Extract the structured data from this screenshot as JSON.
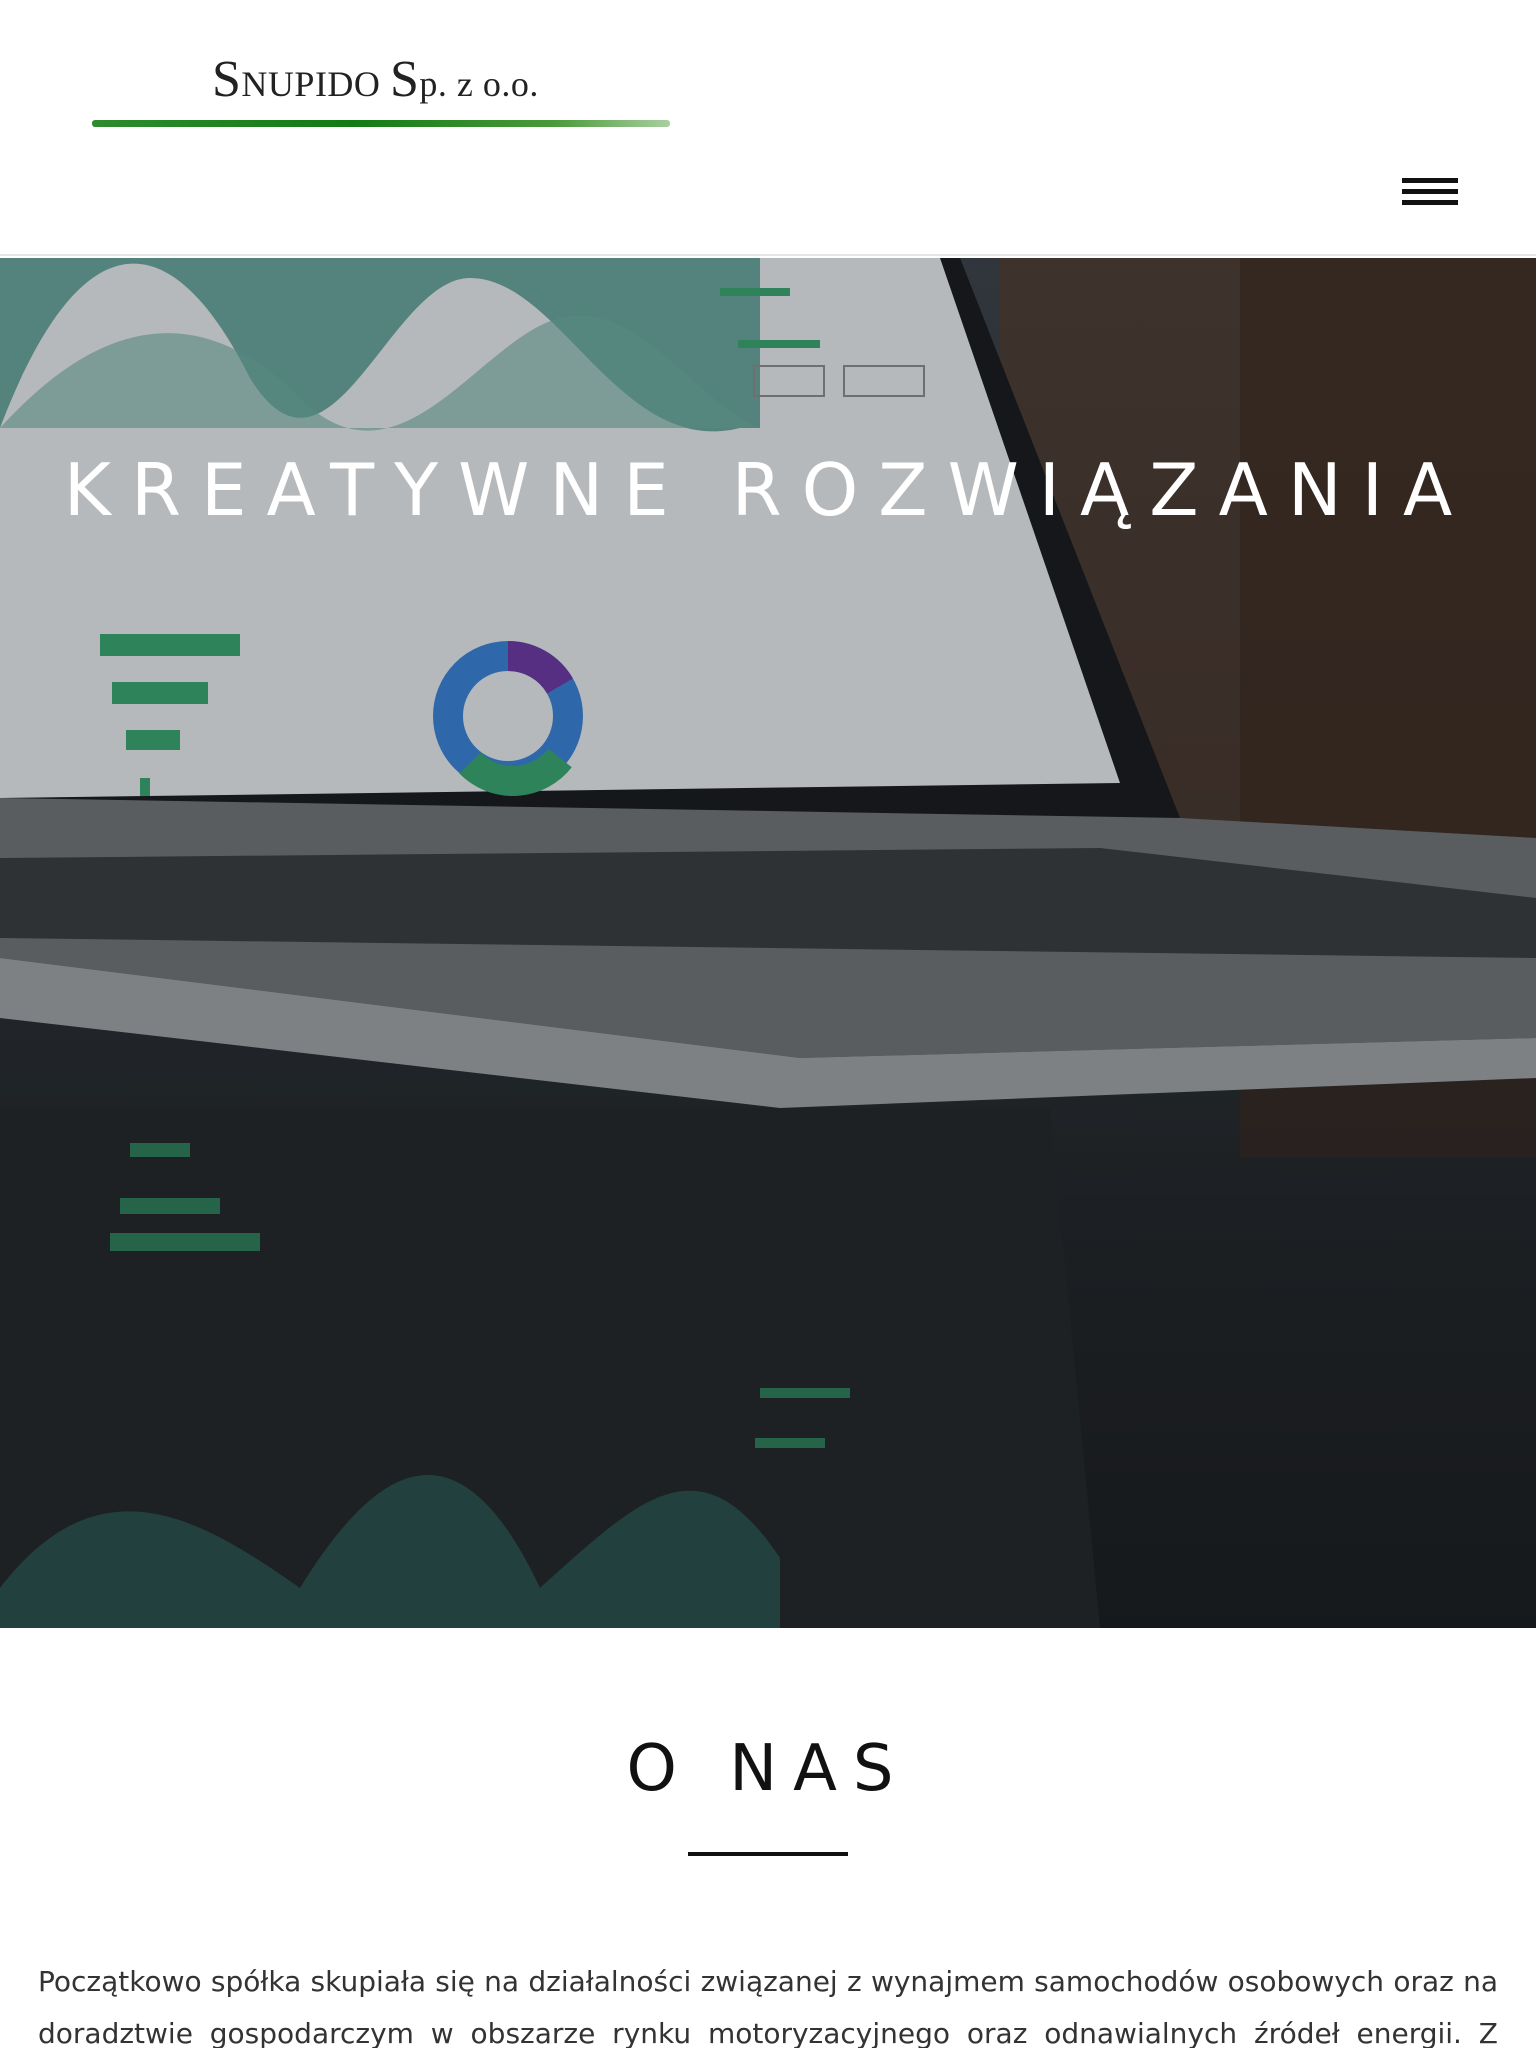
{
  "header": {
    "logo": {
      "s1": "S",
      "r1": "NUPIDO ",
      "s2": "S",
      "r2": "p. z o.o."
    },
    "menu_icon": "hamburger-icon"
  },
  "hero": {
    "title": "KREATYWNE ROZWIĄZANIA"
  },
  "about": {
    "title": "O NAS",
    "paragraph": "Początkowo spółka skupiała się na działalności związanej z wynajmem samochodów osobowych oraz na doradztwie gospodarczym w obszarze rynku motoryzacyjnego oraz odnawialnych źródeł energii. Z czasem"
  },
  "colors": {
    "logo_line": "#137a13",
    "hero_text": "#ffffff",
    "text": "#333333"
  }
}
